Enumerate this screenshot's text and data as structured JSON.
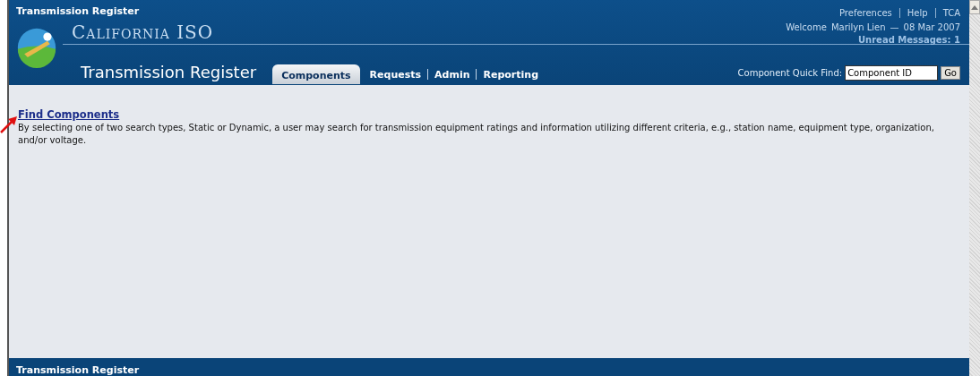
{
  "app_title": "Transmission Register",
  "brand": {
    "org": "California ISO",
    "product": "Transmission Register"
  },
  "top_links": [
    "Preferences",
    "Help",
    "TCA"
  ],
  "welcome": {
    "label": "Welcome",
    "user": "Marilyn Lien",
    "separator": "—",
    "date": "08 Mar 2007"
  },
  "unread": {
    "label": "Unread Messages:",
    "count": "1"
  },
  "tabs": [
    {
      "label": "Components",
      "selected": true
    },
    {
      "label": "Requests",
      "selected": false
    },
    {
      "label": "Admin",
      "selected": false
    },
    {
      "label": "Reporting",
      "selected": false
    }
  ],
  "quick_find": {
    "label": "Component Quick Find:",
    "value": "Component ID",
    "button": "Go"
  },
  "content": {
    "link": "Find Components",
    "description": "By selecting one of two search types, Static or Dynamic, a user may search for transmission equipment ratings and information utilizing different criteria, e.g., station name, equipment type, organization, and/or voltage."
  },
  "footer": {
    "title": "Transmission Register"
  }
}
